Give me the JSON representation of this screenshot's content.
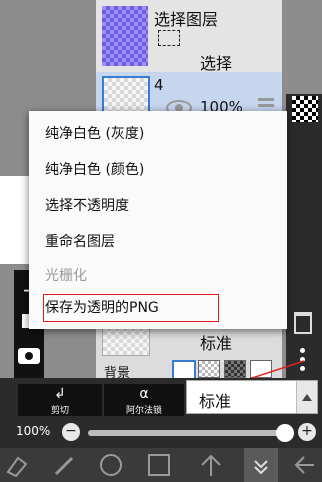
{
  "layers": {
    "selection_layer": {
      "title": "选择图层",
      "select_label": "选择"
    },
    "layer_4": {
      "name": "4",
      "opacity": "100%"
    },
    "bottom_layer": {
      "blend_mode": "标准",
      "background_label": "背景"
    }
  },
  "context_menu": {
    "items": [
      {
        "label": "纯净白色 (灰度)",
        "enabled": true
      },
      {
        "label": "纯净白色 (颜色)",
        "enabled": true
      },
      {
        "label": "选择不透明度",
        "enabled": true
      },
      {
        "label": "重命名图层",
        "enabled": true
      },
      {
        "label": "光栅化",
        "enabled": false
      },
      {
        "label": "保存为透明的PNG",
        "enabled": true,
        "highlighted": true
      }
    ]
  },
  "bottom_panel": {
    "clip_label": "剪切",
    "alpha_lock_label": "阿尔法锁",
    "blend_mode_value": "标准",
    "opacity_value": "100%",
    "minus_label": "−",
    "plus_label": "+"
  },
  "toolbar": {
    "icons": [
      "eraser-icon",
      "brush-icon",
      "ellipse-icon",
      "rectangle-icon",
      "arrow-up-icon",
      "chevron-down-icon",
      "back-arrow-icon"
    ]
  },
  "colors": {
    "highlight_box": "#e02020",
    "accent": "#3a7bd5"
  }
}
